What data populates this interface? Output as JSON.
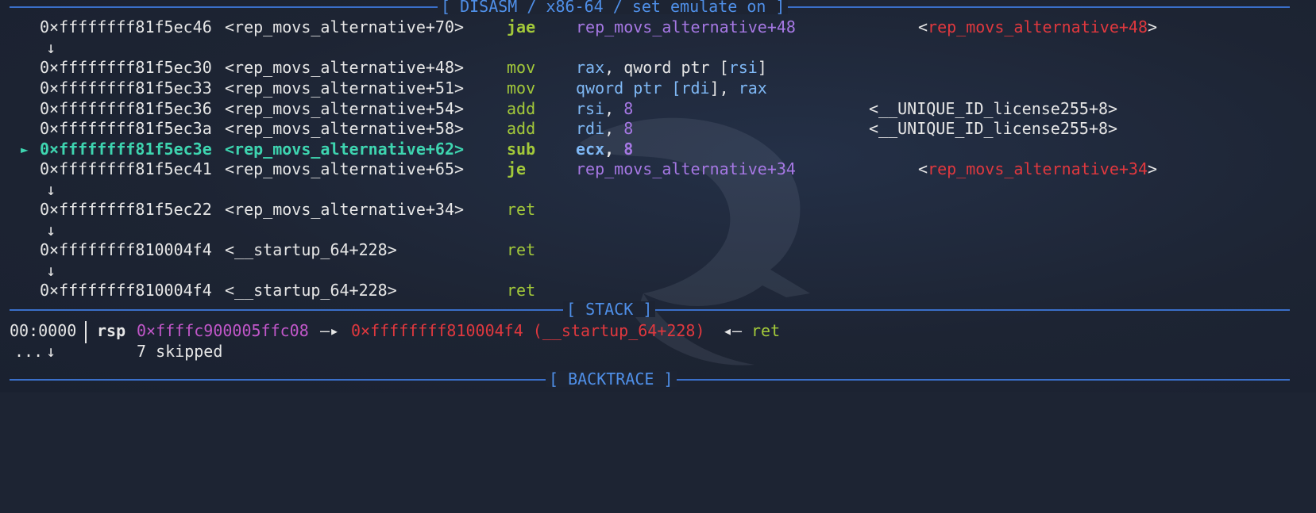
{
  "colors": {
    "background": "#1d2433",
    "separator": "#3a6fc9",
    "mnemonic": "#a3c93a",
    "register": "#7fb8f5",
    "immediate": "#a678e4",
    "current": "#3ed5b0",
    "jump_target": "#e0383e"
  },
  "disasm": {
    "title": "[ DISASM / x86-64 / set emulate on ]",
    "rows": [
      {
        "addr": "0×ffffffff81f5ec46",
        "sym": "<rep_movs_alternative+70>",
        "mn": "jae",
        "op": "rep_movs_alternative+48",
        "cm_l": "<",
        "cm": "rep_movs_alternative+48",
        "cm_r": ">"
      },
      {
        "arrow": "↓"
      },
      {
        "addr": "0×ffffffff81f5ec30",
        "sym": "<rep_movs_alternative+48>",
        "mn": "mov",
        "op1": "rax",
        "op2": ", qword ptr [",
        "op3": "rsi",
        "op4": "]"
      },
      {
        "addr": "0×ffffffff81f5ec33",
        "sym": "<rep_movs_alternative+51>",
        "mn": "mov",
        "op1": "qword ptr [",
        "op2": "rdi",
        "op3": "], ",
        "op4": "rax"
      },
      {
        "addr": "0×ffffffff81f5ec36",
        "sym": "<rep_movs_alternative+54>",
        "mn": "add",
        "op1": "rsi",
        "op2": ", ",
        "op3": "8",
        "cm": "<__UNIQUE_ID_license255+8>"
      },
      {
        "addr": "0×ffffffff81f5ec3a",
        "sym": "<rep_movs_alternative+58>",
        "mn": "add",
        "op1": "rdi",
        "op2": ", ",
        "op3": "8",
        "cm": "<__UNIQUE_ID_license255+8>"
      },
      {
        "marker": "►",
        "addr": "0×ffffffff81f5ec3e",
        "sym": "<rep_movs_alternative+62>",
        "mn": "sub",
        "op1": "ecx",
        "op2": ", ",
        "op3": "8"
      },
      {
        "addr": "0×ffffffff81f5ec41",
        "sym": "<rep_movs_alternative+65>",
        "mn": "je",
        "op": "rep_movs_alternative+34",
        "cm_l": "<",
        "cm": "rep_movs_alternative+34",
        "cm_r": ">"
      },
      {
        "arrow": "↓"
      },
      {
        "addr": "0×ffffffff81f5ec22",
        "sym": "<rep_movs_alternative+34>",
        "mn": "ret"
      },
      {
        "arrow": "↓"
      },
      {
        "addr": "0×ffffffff810004f4",
        "sym": "<__startup_64+228>",
        "mn": "ret"
      },
      {
        "arrow": "↓"
      },
      {
        "addr": "0×ffffffff810004f4",
        "sym": "<__startup_64+228>",
        "mn": "ret"
      }
    ]
  },
  "stack": {
    "title": "[ STACK ]",
    "idx": "00:0000",
    "reg": "rsp",
    "ptr": "0×ffffc900005ffc08",
    "arrow1": "—▸",
    "target": "0×ffffffff810004f4 (__startup_64+228)",
    "arrow2": "◂—",
    "value": "ret",
    "skip_dots": "...",
    "skip_arrow": "↓",
    "skip_text": "7 skipped"
  },
  "backtrace": {
    "title": "[ BACKTRACE ]"
  }
}
